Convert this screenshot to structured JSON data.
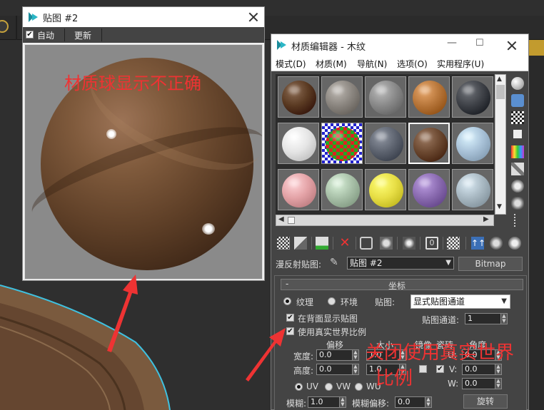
{
  "map_window": {
    "title": "贴图 #2",
    "auto_label": "自动",
    "auto_checked": true,
    "update_label": "更新",
    "warning": "材质球显示不正确"
  },
  "material_editor": {
    "title": "材质编辑器 - 木纹",
    "menu": [
      "模式(D)",
      "材质(M)",
      "导航(N)",
      "选项(O)",
      "实用程序(U)"
    ],
    "slots": [
      {
        "color": "#5a3a22",
        "kind": "wood"
      },
      {
        "color": "#8b8680",
        "kind": "stone"
      },
      {
        "color": "#8a8a8a",
        "kind": "concrete"
      },
      {
        "color": "#b7763a",
        "kind": "orange"
      },
      {
        "color": "#3f4248",
        "kind": "dark"
      },
      {
        "color": "#e5e5e5",
        "kind": "white"
      },
      {
        "color": "#c7c7c7",
        "kind": "checker"
      },
      {
        "color": "#5e6470",
        "kind": "slate"
      },
      {
        "color": "#6b4830",
        "kind": "wood-selected"
      },
      {
        "color": "#a9c2d8",
        "kind": "lightblue"
      },
      {
        "color": "#e3a2a6",
        "kind": "pink"
      },
      {
        "color": "#a8c0a8",
        "kind": "sage"
      },
      {
        "color": "#e7de45",
        "kind": "yellow"
      },
      {
        "color": "#8a6bb0",
        "kind": "purple"
      },
      {
        "color": "#a8b8c2",
        "kind": "bluegray"
      }
    ],
    "diffuse_map_label": "漫反射贴图:",
    "map_name": "贴图 #2",
    "map_type": "Bitmap",
    "rollout": {
      "title": "坐标",
      "texture_label": "纹理",
      "environ_label": "环境",
      "mapping_label": "贴图:",
      "mapping_value": "显式贴图通道",
      "show_back_label": "在背面显示贴图",
      "show_back_checked": true,
      "channel_label": "贴图通道:",
      "channel_value": "1",
      "real_world_label": "使用真实世界比例",
      "real_world_checked": true,
      "offset_header": "偏移",
      "size_header": "大小",
      "mirror_header": "镜像",
      "tile_header": "瓷砖",
      "angle_header": "角度",
      "width_label": "宽度:",
      "height_label": "高度:",
      "width_offset": "0.0",
      "height_offset": "0.0",
      "width_size": "1.0",
      "height_size": "1.0",
      "u_label": "U:",
      "v_label": "V:",
      "w_label": "W:",
      "u_angle": "0.0",
      "v_angle": "0.0",
      "w_angle": "0.0",
      "uv_label": "UV",
      "vw_label": "VW",
      "wu_label": "WU",
      "blur_label": "模糊:",
      "blur_value": "1.0",
      "blur_offset_label": "模糊偏移:",
      "blur_offset_value": "0.0",
      "rotate_label": "旋转"
    }
  },
  "annotation": {
    "line1": "关闭使用真实世界",
    "line2": "比例",
    "color": "#ee3333"
  }
}
